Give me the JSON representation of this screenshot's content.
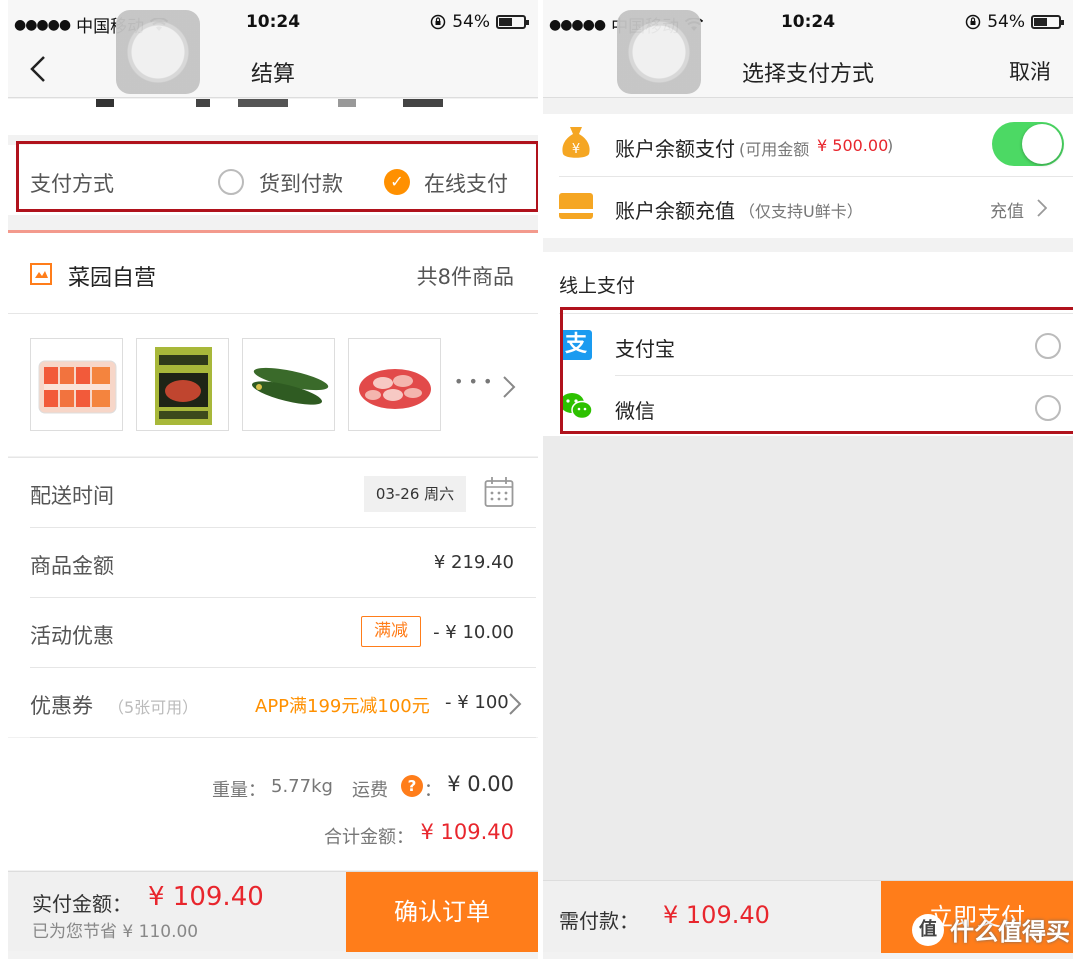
{
  "status_bar": {
    "carrier": "中国移动",
    "signal": "●●●●●",
    "time": "10:24",
    "battery": "54%"
  },
  "checkout": {
    "title": "结算",
    "payment_label": "支付方式",
    "option_cod": "货到付款",
    "option_online": "在线支付",
    "store_name": "菜园自营",
    "item_count": "共8件商品",
    "more": "• • •",
    "delivery_label": "配送时间",
    "delivery_date": "03-26 周六",
    "goods_label": "商品金额",
    "goods_amount": "¥ 219.40",
    "promo_label": "活动优惠",
    "promo_badge": "满减",
    "promo_amount": "- ¥ 10.00",
    "coupon_label": "优惠券",
    "coupon_available": "（5张可用）",
    "coupon_desc": "APP满199元减100元",
    "coupon_amount": "- ¥ 100",
    "weight_label": "重量：",
    "weight_value": "5.77kg",
    "shipping_label": "运费",
    "shipping_help": "?",
    "shipping_colon": "：",
    "shipping_amount": "¥ 0.00",
    "total_label": "合计金额：",
    "total_amount": "¥ 109.40",
    "pay_label": "实付金额：",
    "pay_amount": "¥ 109.40",
    "saved_text": "已为您节省 ¥ 110.00",
    "confirm_button": "确认订单"
  },
  "pay_method": {
    "title": "选择支付方式",
    "cancel": "取消",
    "balance_label": "账户余额支付",
    "balance_avail_prefix": "(可用金额",
    "balance_avail_amount": "¥ 500.00",
    "balance_avail_suffix": ")",
    "balance_enabled": true,
    "recharge_label": "账户余额充值",
    "recharge_note": "（仅支持U鲜卡）",
    "recharge_action": "充值",
    "online_section": "线上支付",
    "alipay_label": "支付宝",
    "wechat_label": "微信",
    "due_label": "需付款：",
    "due_amount": "¥ 109.40",
    "pay_button": "立即支付"
  },
  "watermark": {
    "logo": "值",
    "text": "什么值得买"
  },
  "colors": {
    "orange": "#ff7d1a",
    "red": "#e8262d",
    "highlight_box": "#b0121c",
    "toggle_on": "#4cd964"
  }
}
